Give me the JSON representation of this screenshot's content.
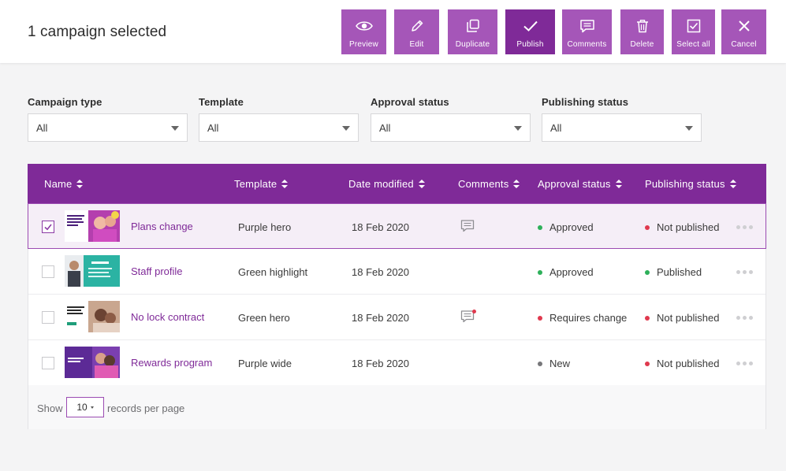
{
  "header": {
    "title": "1 campaign selected"
  },
  "toolbar": [
    {
      "label": "Preview",
      "icon": "eye-icon"
    },
    {
      "label": "Edit",
      "icon": "pencil-icon"
    },
    {
      "label": "Duplicate",
      "icon": "duplicate-icon"
    },
    {
      "label": "Publish",
      "icon": "check-icon"
    },
    {
      "label": "Comments",
      "icon": "comment-icon"
    },
    {
      "label": "Delete",
      "icon": "trash-icon"
    },
    {
      "label": "Select all",
      "icon": "checkbox-icon"
    },
    {
      "label": "Cancel",
      "icon": "close-icon"
    }
  ],
  "filters": [
    {
      "label": "Campaign type",
      "value": "All"
    },
    {
      "label": "Template",
      "value": "All"
    },
    {
      "label": "Approval status",
      "value": "All"
    },
    {
      "label": "Publishing status",
      "value": "All"
    }
  ],
  "table": {
    "headers": [
      "Name",
      "Template",
      "Date modified",
      "Comments",
      "Approval status",
      "Publishing status"
    ],
    "rows": [
      {
        "name": "Plans change",
        "template": "Purple hero",
        "date": "18 Feb 2020",
        "has_comment": true,
        "comment_unread": false,
        "approval": "Approved",
        "approval_color": "#2eb05a",
        "publishing": "Not published",
        "publishing_color": "#e0394e",
        "selected": true,
        "thumb_text": "Plans change. So will be changed rule."
      },
      {
        "name": "Staff profile",
        "template": "Green highlight",
        "date": "18 Feb 2020",
        "has_comment": false,
        "comment_unread": false,
        "approval": "Approved",
        "approval_color": "#2eb05a",
        "publishing": "Published",
        "publishing_color": "#2eb05a",
        "selected": false,
        "thumb_text": "John Doe"
      },
      {
        "name": "No lock contract",
        "template": "Green hero",
        "date": "18 Feb 2020",
        "has_comment": true,
        "comment_unread": true,
        "approval": "Requires change",
        "approval_color": "#e0394e",
        "publishing": "Not published",
        "publishing_color": "#e0394e",
        "selected": false,
        "thumb_text": "Welcome rates. No lock-in contracts."
      },
      {
        "name": "Rewards program",
        "template": "Purple wide",
        "date": "18 Feb 2020",
        "has_comment": false,
        "comment_unread": false,
        "approval": "New",
        "approval_color": "#77777a",
        "publishing": "Not published",
        "publishing_color": "#e0394e",
        "selected": false,
        "thumb_text": ""
      }
    ]
  },
  "pagination": {
    "show_label": "Show",
    "per_page": "10",
    "suffix": "records per page"
  },
  "colors": {
    "brand": "#7f2a98",
    "brand_light": "#a556b8",
    "approved": "#2eb05a",
    "alert": "#e0394e",
    "neutral": "#77777a"
  }
}
